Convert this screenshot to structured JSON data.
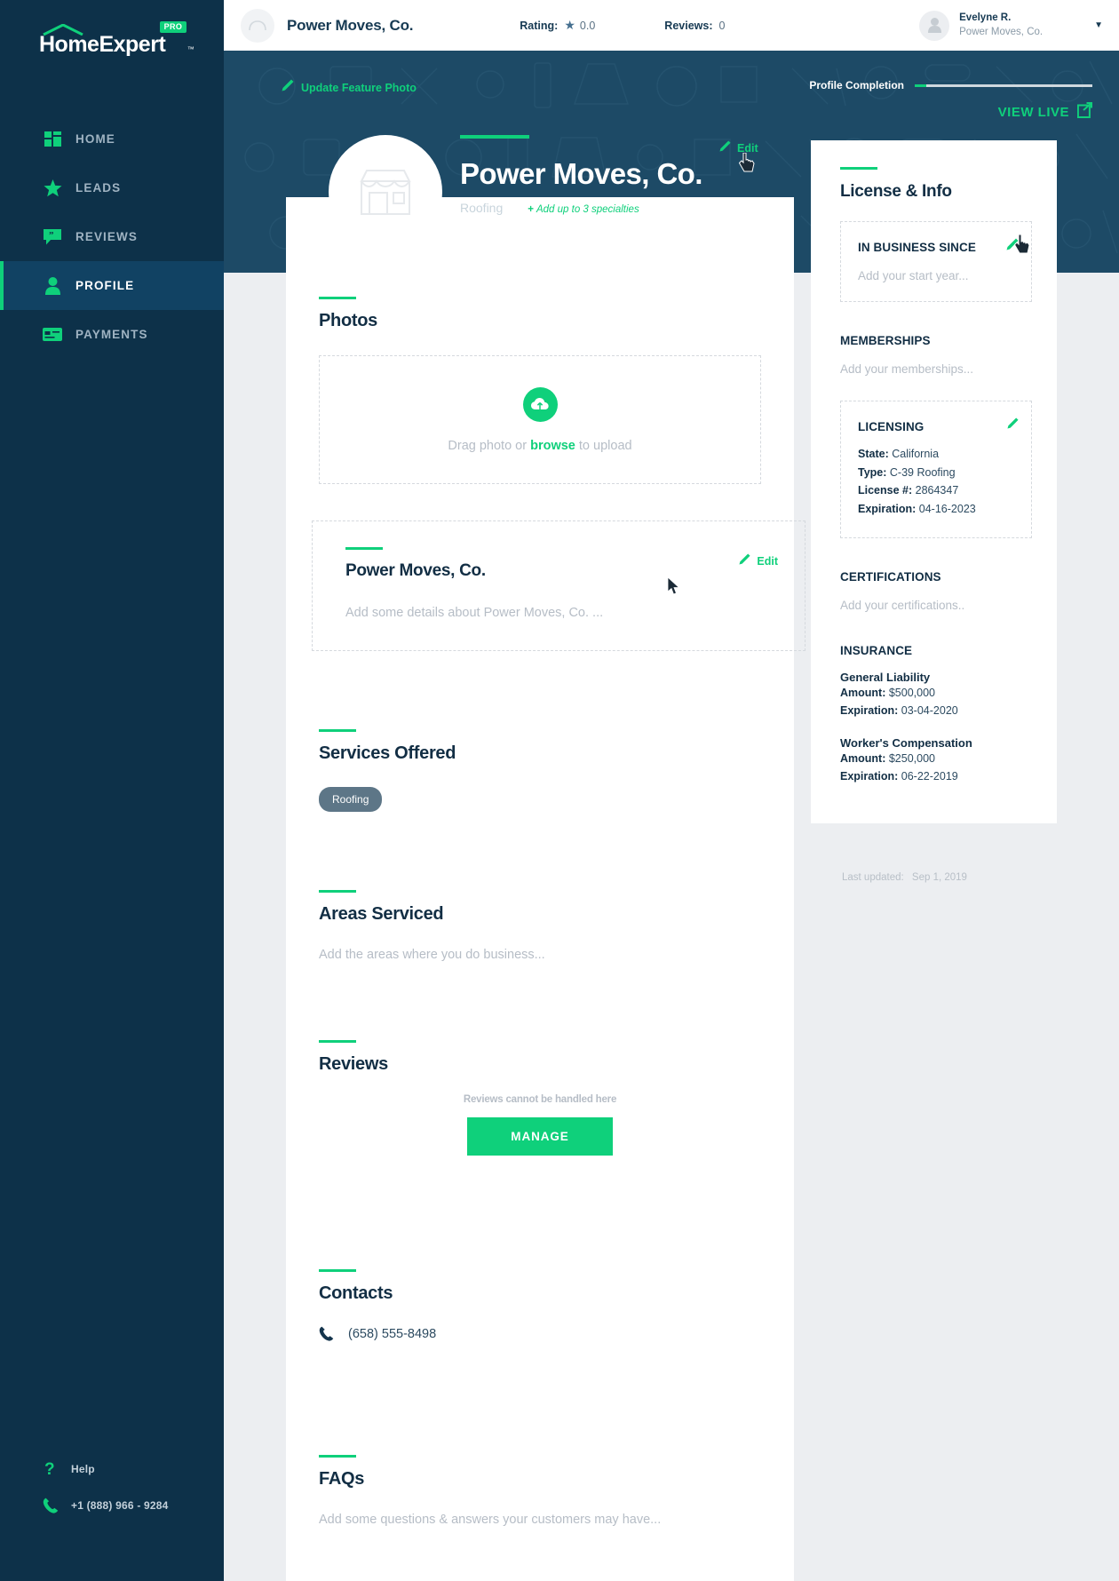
{
  "brand": {
    "name": "HomeExpert",
    "badge": "PRO",
    "tm": "™",
    "accent": "#0fd07b",
    "sidebar_bg": "#0d3149",
    "hero_bg": "#1d4a66"
  },
  "sidebar": {
    "items": [
      {
        "label": "HOME",
        "icon": "dashboard-icon",
        "active": false
      },
      {
        "label": "LEADS",
        "icon": "star-icon",
        "active": false
      },
      {
        "label": "REVIEWS",
        "icon": "comment-icon",
        "active": false
      },
      {
        "label": "PROFILE",
        "icon": "person-icon",
        "active": true
      },
      {
        "label": "PAYMENTS",
        "icon": "credit-card-icon",
        "active": false
      }
    ],
    "footer": {
      "help_label": "Help",
      "phone": "+1 (888) 966 - 9284"
    }
  },
  "topbar": {
    "company": "Power Moves, Co.",
    "rating_label": "Rating:",
    "rating_value": "0.0",
    "reviews_label": "Reviews:",
    "reviews_value": "0",
    "user_name": "Evelyne R.",
    "user_company": "Power Moves, Co.",
    "caret": "▼"
  },
  "hero": {
    "update_photo": "Update Feature Photo",
    "completion_label": "Profile Completion",
    "view_live": "VIEW LIVE",
    "business_name": "Power Moves, Co.",
    "specialty": "Roofing",
    "add_specialties": "Add up to 3 specialties",
    "edit_label": "Edit"
  },
  "main": {
    "photos": {
      "title": "Photos",
      "drop_prefix": "Drag photo or ",
      "drop_link": "browse",
      "drop_suffix": " to upload"
    },
    "description": {
      "title": "Power Moves, Co.",
      "placeholder": "Add some details about Power Moves, Co. ...",
      "edit_label": "Edit"
    },
    "services": {
      "title": "Services Offered",
      "chips": [
        "Roofing"
      ]
    },
    "areas": {
      "title": "Areas Serviced",
      "placeholder": "Add the areas where you do business..."
    },
    "reviews": {
      "title": "Reviews",
      "note": "Reviews cannot be handled here",
      "button": "MANAGE"
    },
    "contacts": {
      "title": "Contacts",
      "phone": "(658) 555-8498"
    },
    "faqs": {
      "title": "FAQs",
      "placeholder": "Add some questions & answers your customers may have..."
    }
  },
  "right_panel": {
    "title": "License & Info",
    "in_business": {
      "heading": "IN BUSINESS SINCE",
      "placeholder": "Add your start year..."
    },
    "memberships": {
      "heading": "MEMBERSHIPS",
      "placeholder": "Add your memberships..."
    },
    "licensing": {
      "heading": "LICENSING",
      "rows": [
        {
          "label": "State:",
          "value": "California"
        },
        {
          "label": "Type:",
          "value": "C-39 Roofing"
        },
        {
          "label": "License #:",
          "value": "2864347"
        },
        {
          "label": "Expiration:",
          "value": "04-16-2023"
        }
      ]
    },
    "certifications": {
      "heading": "CERTIFICATIONS",
      "placeholder": "Add your certifications.."
    },
    "insurance": {
      "heading": "INSURANCE",
      "policies": [
        {
          "name": "General Liability",
          "rows": [
            {
              "label": "Amount:",
              "value": "$500,000"
            },
            {
              "label": "Expiration:",
              "value": "03-04-2020"
            }
          ]
        },
        {
          "name": "Worker's Compensation",
          "rows": [
            {
              "label": "Amount:",
              "value": "$250,000"
            },
            {
              "label": "Expiration:",
              "value": "06-22-2019"
            }
          ]
        }
      ]
    },
    "last_updated_label": "Last updated:",
    "last_updated_value": "Sep 1, 2019"
  }
}
